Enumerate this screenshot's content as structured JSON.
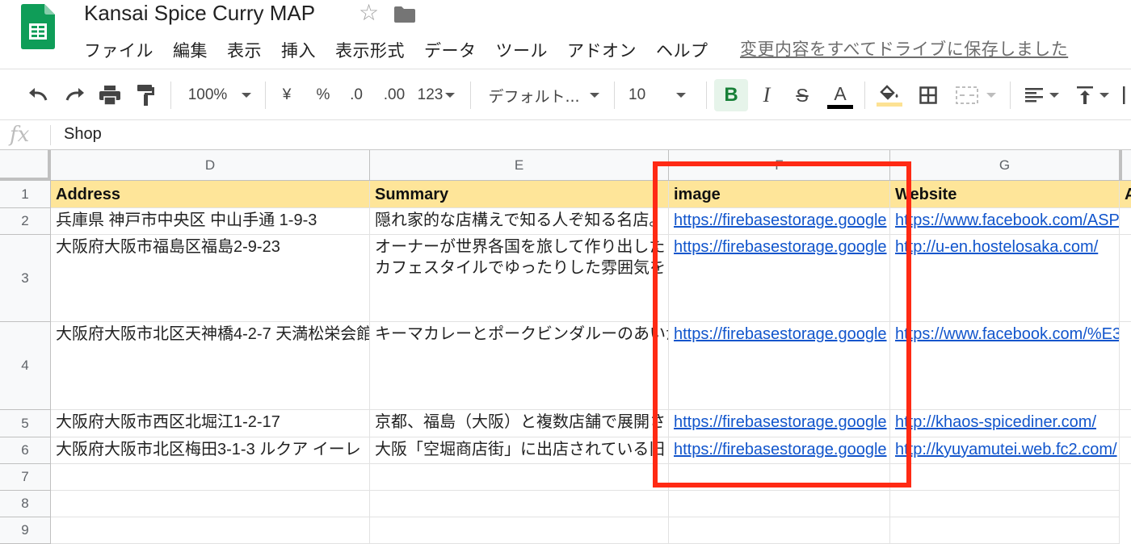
{
  "app": {
    "doc_title": "Kansai Spice Curry MAP",
    "menu": [
      "ファイル",
      "編集",
      "表示",
      "挿入",
      "表示形式",
      "データ",
      "ツール",
      "アドオン",
      "ヘルプ"
    ],
    "save_status": "変更内容をすべてドライブに保存しました"
  },
  "toolbar": {
    "zoom": "100%",
    "currency": "¥",
    "percent": "%",
    "decimal_decrease": ".0",
    "decimal_increase": ".00",
    "number_format": "123",
    "font": "デフォルト...",
    "font_size": "10",
    "bold": "B",
    "italic": "I",
    "strikethrough": "S",
    "text_color": "A",
    "text_color_bar": "#000000",
    "fill_color_bar": "#fde293"
  },
  "formula_bar": {
    "value": "Shop"
  },
  "grid": {
    "columns": [
      "D",
      "E",
      "F",
      "G"
    ],
    "row_numbers": [
      "1",
      "2",
      "3",
      "4",
      "5",
      "6",
      "7",
      "8",
      "9"
    ],
    "header_row": [
      "Address",
      "Summary",
      "image",
      "Website",
      "A"
    ],
    "rows": [
      {
        "address": "兵庫県 神戸市中央区 中山手通 1-9-3",
        "summary": [
          "隠れ家的な店構えで知る人ぞ知る名店。"
        ],
        "image": "https://firebasestorage.google",
        "website": "https://www.facebook.com/ASP"
      },
      {
        "address": "大阪府大阪市福島区福島2-9-23",
        "summary": [
          "オーナーが世界各国を旅して作り出した",
          "カフェスタイルでゆったりした雰囲気を"
        ],
        "image": "https://firebasestorage.google",
        "website": "http://u-en.hostelosaka.com/"
      },
      {
        "address": "大阪府大阪市北区天神橋4-2-7 天満松栄会館",
        "summary": [
          "キーマカレーとポークビンダルーのあいがけ"
        ],
        "image": "https://firebasestorage.google",
        "website": "https://www.facebook.com/%E3"
      },
      {
        "address": "大阪府大阪市西区北堀江1-2-17",
        "summary": [
          "京都、福島（大阪）と複数店舗で展開さ"
        ],
        "image": "https://firebasestorage.google",
        "website": "http://khaos-spicediner.com/"
      },
      {
        "address": "大阪府大阪市北区梅田3-1-3 ルクア イーレ",
        "summary": [
          "大阪「空堀商店街」に出店されている旧"
        ],
        "image": "https://firebasestorage.google",
        "website": "http://kyuyamutei.web.fc2.com/"
      }
    ]
  },
  "colors": {
    "header_fill": "#fee599",
    "link": "#1155cc",
    "annotation_box": "#ff2a14",
    "sheets_green": "#0f9d58"
  }
}
